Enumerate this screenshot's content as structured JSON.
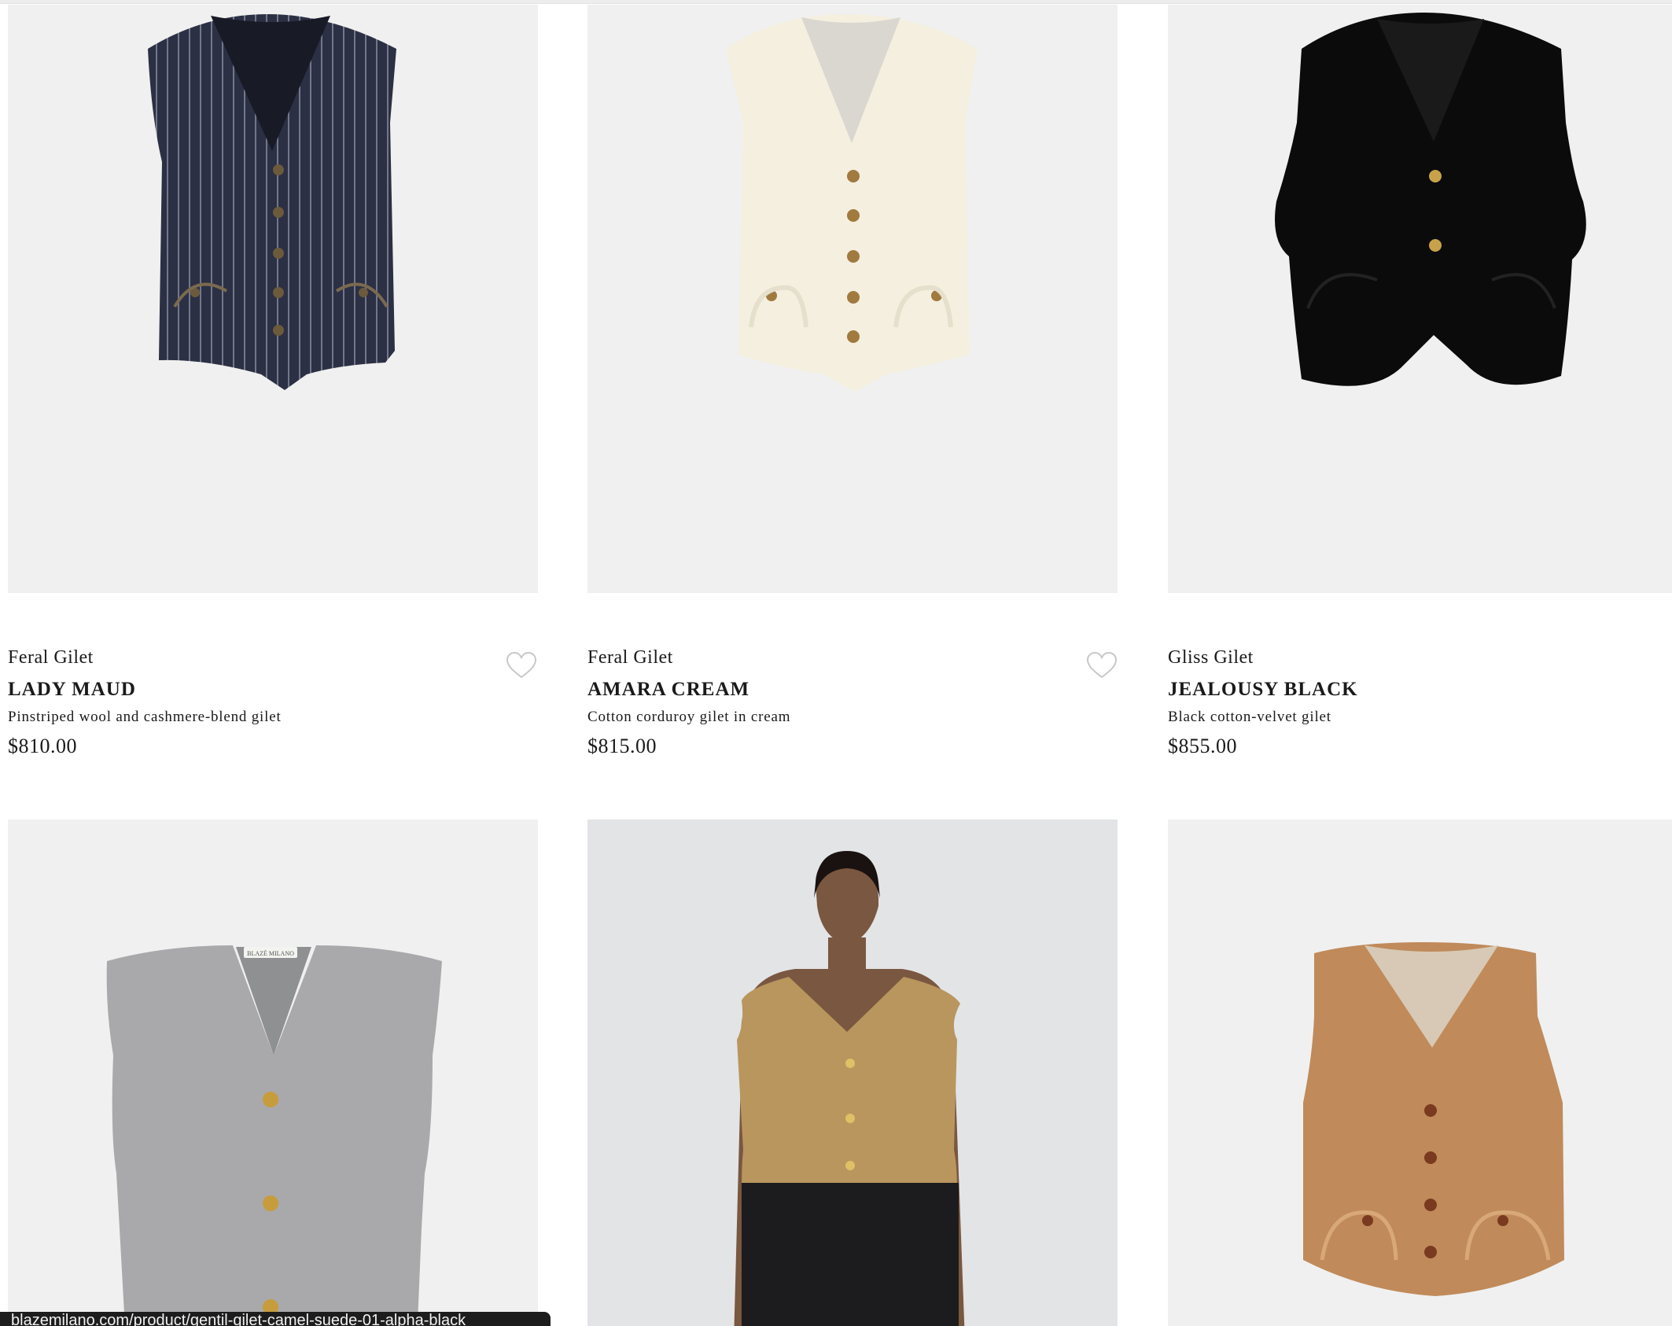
{
  "products": [
    {
      "collection": "Feral Gilet",
      "name": "LADY MAUD",
      "description": "Pinstriped wool and cashmere-blend gilet",
      "price": "$810.00",
      "image": "navy-pinstripe-vest",
      "color": "#2c3044"
    },
    {
      "collection": "Feral Gilet",
      "name": "AMARA CREAM",
      "description": "Cotton corduroy gilet in cream",
      "price": "$815.00",
      "image": "cream-corduroy-vest",
      "color": "#f4efdf"
    },
    {
      "collection": "Gliss Gilet",
      "name": "JEALOUSY BLACK",
      "description": "Black cotton-velvet gilet",
      "price": "$855.00",
      "image": "black-velvet-vest",
      "color": "#0b0b0b"
    },
    {
      "image": "grey-knit-vest",
      "label_text": "BLAZÉ MILANO",
      "color": "#a9a9ab"
    },
    {
      "image": "model-camel-knit-vest",
      "color": "#b8965e"
    },
    {
      "image": "tan-suede-vest",
      "color": "#c08a5a"
    }
  ],
  "icons": {
    "wishlist": "heart-outline-icon"
  },
  "status_bar": {
    "url": "blazemilano.com/product/gentil-gilet-camel-suede-01-alpha-black"
  }
}
